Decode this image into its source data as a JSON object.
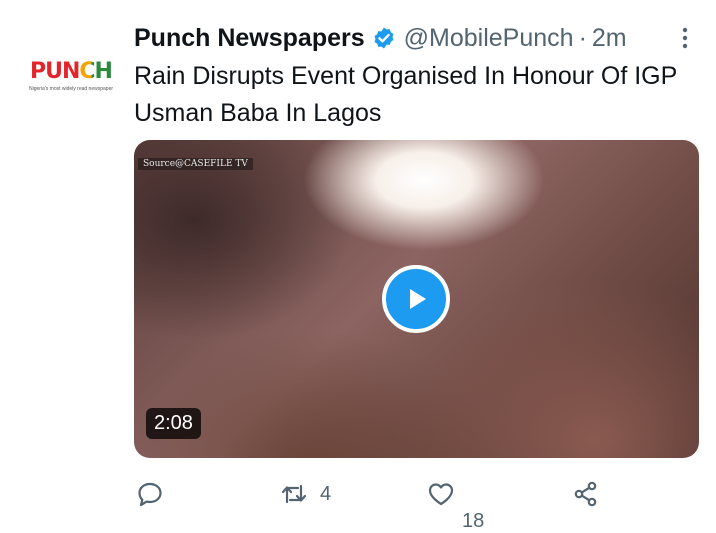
{
  "tweet": {
    "author_name": "Punch Newspapers",
    "handle": "@MobilePunch",
    "separator": "·",
    "time": "2m",
    "text": "Rain Disrupts Event Organised In Honour Of IGP Usman Baba In Lagos",
    "avatar": {
      "logo_text": "PUNCH",
      "tagline": "Nigeria's most widely read newspaper"
    },
    "media": {
      "source_label": "Source@CASEFILE TV",
      "duration": "2:08"
    },
    "actions": {
      "reply_count": "",
      "retweet_count": "4",
      "like_count": "18",
      "share_count": ""
    }
  },
  "icons": [
    "verified-badge-icon",
    "more-options-icon",
    "play-icon",
    "reply-icon",
    "retweet-icon",
    "like-icon",
    "share-icon"
  ],
  "colors": {
    "accent": "#1d9bf0",
    "text": "#0f1419",
    "muted": "#536471"
  }
}
